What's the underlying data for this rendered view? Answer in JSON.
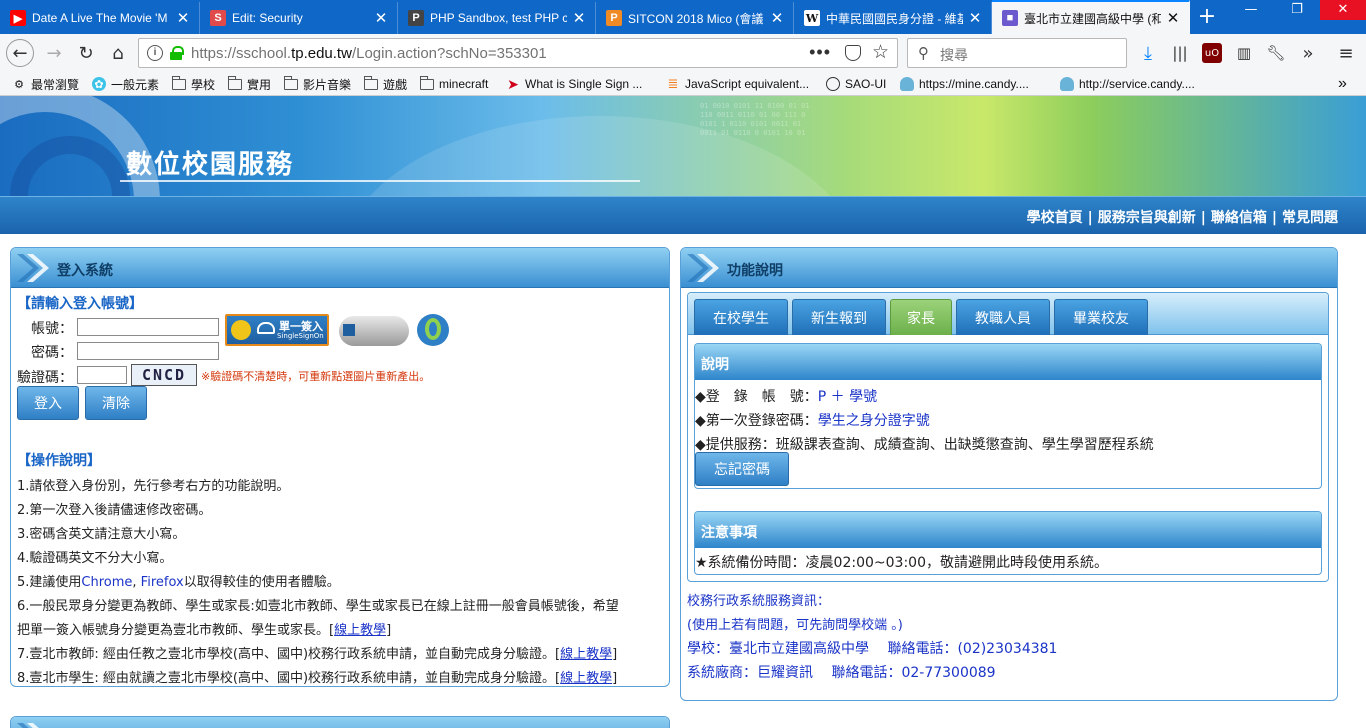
{
  "browser": {
    "tabs": [
      {
        "title": "Date A Live The Movie 'M",
        "icon": "youtube-icon",
        "color": "#ff0000",
        "glyph": "▶"
      },
      {
        "title": "Edit: Security",
        "icon": "s-icon",
        "color": "#e04a4a",
        "glyph": "S"
      },
      {
        "title": "PHP Sandbox, test PHP c",
        "icon": "php-icon",
        "color": "#444444",
        "glyph": "P"
      },
      {
        "title": "SITCON 2018 Mico (會議",
        "icon": "p-icon",
        "color": "#f08a24",
        "glyph": "P"
      },
      {
        "title": "中華民國國民身分證 - 維基",
        "icon": "wikipedia-icon",
        "color": "#ffffff",
        "glyph": "W"
      },
      {
        "title": "臺北市立建國高級中學 (和",
        "icon": "book-icon",
        "color": "#6a5acd",
        "glyph": "■"
      }
    ],
    "url_prefix": "https://sschool.",
    "url_domain": "tp.edu.tw",
    "url_suffix": "/Login.action?schNo=353301",
    "search_placeholder": "搜尋",
    "bookmarks": [
      {
        "label": "最常瀏覽",
        "icon": "gear-icon"
      },
      {
        "label": "一般元素",
        "icon": "cloud-icon"
      },
      {
        "label": "學校",
        "icon": "folder-icon"
      },
      {
        "label": "實用",
        "icon": "folder-icon"
      },
      {
        "label": "影片音樂",
        "icon": "folder-icon"
      },
      {
        "label": "遊戲",
        "icon": "folder-icon"
      },
      {
        "label": "minecraft",
        "icon": "folder-icon"
      },
      {
        "label": "What is Single Sign ...",
        "icon": "bird-icon"
      },
      {
        "label": "JavaScript equivalent...",
        "icon": "stack-icon"
      },
      {
        "label": "SAO-UI",
        "icon": "globe-icon"
      },
      {
        "label": "https://mine.candy....",
        "icon": "candy-icon"
      },
      {
        "label": "http://service.candy....",
        "icon": "candy-icon"
      }
    ]
  },
  "banner": {
    "title": "數位校園服務"
  },
  "topnav": {
    "links": [
      "學校首頁",
      "服務宗旨與創新",
      "聯絡信箱",
      "常見問題"
    ]
  },
  "login": {
    "panel_title": "登入系統",
    "prompt": "【請輸入登入帳號】",
    "account_label": "帳號：",
    "password_label": "密碼：",
    "captcha_label": "驗證碼：",
    "captcha_text": "CNCD",
    "captcha_hint": "※驗證碼不清楚時，可重新點選圖片重新產出。",
    "sso_title": "單一簽入",
    "sso_sub": "SingleSignOn",
    "login_button": "登入",
    "clear_button": "清除",
    "ops_title": "【操作說明】",
    "ops": [
      "1.請依登入身份別，先行參考右方的功能說明。",
      "2.第一次登入後請儘速修改密碼。",
      "3.密碼含英文請注意大小寫。",
      "4.驗證碼英文不分大小寫。"
    ],
    "op5_pre": "5.建議使用",
    "op5_chrome": "Chrome",
    "op5_comma": ", ",
    "op5_firefox": "Firefox",
    "op5_post": "以取得較佳的使用者體驗。",
    "op6_a": "6.一般民眾身分變更為教師、學生或家長:如壹北市教師、學生或家長已在線上註冊一般會員帳號後，希望",
    "op6_b": "把單一簽入帳號身分變更為壹北市教師、學生或家長。[",
    "op7": "7.壹北市教師: 經由任教之壹北市學校(高中、國中)校務行政系統申請，並自動完成身分驗證。[",
    "op8": "8.壹北市學生: 經由就讀之壹北市學校(高中、國中)校務行政系統申請，並自動完成身分驗證。[",
    "online_teach": "線上教學",
    "close_bracket": "]"
  },
  "features": {
    "panel_title": "功能說明",
    "tabs": [
      "在校學生",
      "新生報到",
      "家長",
      "教職人員",
      "畢業校友"
    ],
    "active_tab": "家長",
    "desc_title": "說明",
    "line1_label": "◆登　錄　帳　號：",
    "line1_value": "P ＋ 學號",
    "line2_label": "◆第一次登錄密碼：",
    "line2_value": "學生之身分證字號",
    "line3": "◆提供服務：班級課表查詢、成績查詢、出缺獎懲查詢、學生學習歷程系統",
    "forgot_button": "忘記密碼",
    "notice_title": "注意事項",
    "notice_text": "★系統備份時間：凌晨02:00~03:00，敬請避開此時段使用系統。",
    "info": [
      "校務行政系統服務資訊：",
      "(使用上若有問題，可先詢問學校端 。)",
      "學校：臺北市立建國高級中學　 聯絡電話：(02)23034381",
      "系統廠商：巨耀資訊　 聯絡電話：02-77300089"
    ]
  }
}
